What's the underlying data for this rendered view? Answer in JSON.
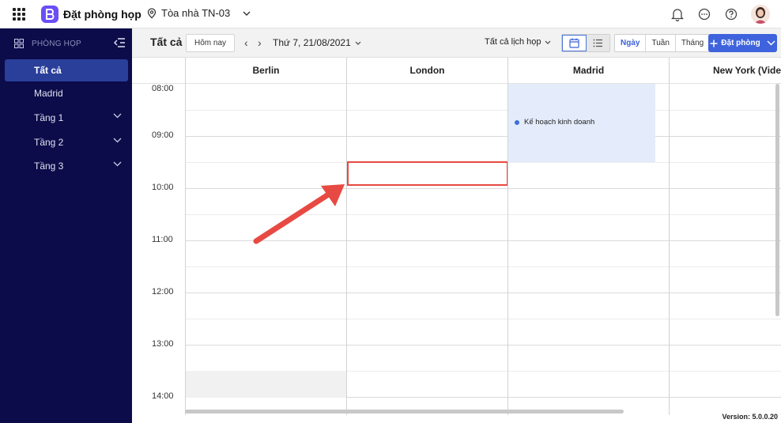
{
  "topbar": {
    "app_title": "Đặt phòng họp",
    "building": "Tòa nhà TN-03",
    "icons": [
      "apps-grid-icon",
      "app-logo",
      "location-icon",
      "chevron-down-icon",
      "bell-icon",
      "chat-icon",
      "help-icon",
      "user-avatar"
    ]
  },
  "sidebar": {
    "header": "PHÒNG HỌP",
    "items": [
      {
        "label": "Tất cả",
        "active": true,
        "expandable": false
      },
      {
        "label": "Madrid",
        "active": false,
        "expandable": false
      },
      {
        "label": "Tầng 1",
        "active": false,
        "expandable": true
      },
      {
        "label": "Tầng 2",
        "active": false,
        "expandable": true
      },
      {
        "label": "Tầng 3",
        "active": false,
        "expandable": true
      }
    ]
  },
  "toolbar": {
    "title": "Tất cả",
    "today_label": "Hôm nay",
    "prev_label": "‹",
    "next_label": "›",
    "date_label": "Thứ 7, 21/08/2021",
    "filter_label": "Tất cả lịch họp",
    "ranges": [
      "Ngày",
      "Tuần",
      "Tháng"
    ],
    "active_range": "Ngày",
    "book_label": "Đặt phòng"
  },
  "calendar": {
    "rooms": [
      "Berlin",
      "London",
      "Madrid",
      "New York (Video)"
    ],
    "times": [
      "08:00",
      "09:00",
      "10:00",
      "11:00",
      "12:00",
      "13:00",
      "14:00"
    ],
    "events": [
      {
        "room": "Madrid",
        "title": "Kế hoạch kinh doanh",
        "start": "08:00",
        "end": "09:30"
      }
    ],
    "selection": {
      "room": "London",
      "start": "09:30",
      "end": "10:00"
    }
  },
  "footer": {
    "version": "Version: 5.0.0.20"
  },
  "colors": {
    "sidebar_bg": "#0c0c4a",
    "sidebar_active": "#2a3f9a",
    "accent": "#3f63dd",
    "event_bg": "#e4ecfb",
    "annotation": "#e74a42"
  }
}
